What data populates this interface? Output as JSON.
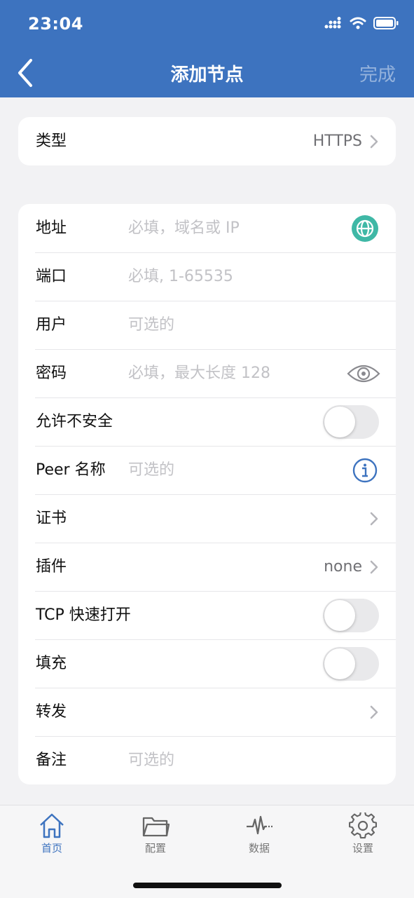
{
  "status": {
    "time": "23:04"
  },
  "nav": {
    "title": "添加节点",
    "done_label": "完成"
  },
  "type_card": {
    "label": "类型",
    "value": "HTTPS"
  },
  "form": {
    "address": {
      "label": "地址",
      "placeholder": "必填，域名或 IP"
    },
    "port": {
      "label": "端口",
      "placeholder": "必填, 1-65535"
    },
    "user": {
      "label": "用户",
      "placeholder": "可选的"
    },
    "password": {
      "label": "密码",
      "placeholder": "必填，最大长度 128"
    },
    "allow_insecure": {
      "label": "允许不安全",
      "on": false
    },
    "peer_name": {
      "label": "Peer 名称",
      "placeholder": "可选的"
    },
    "certificate": {
      "label": "证书"
    },
    "plugin": {
      "label": "插件",
      "value": "none"
    },
    "tcp_fast_open": {
      "label": "TCP 快速打开",
      "on": false
    },
    "padding": {
      "label": "填充",
      "on": false
    },
    "forward": {
      "label": "转发"
    },
    "remark": {
      "label": "备注",
      "placeholder": "可选的"
    }
  },
  "tabs": [
    {
      "label": "首页",
      "icon": "home-icon",
      "active": true
    },
    {
      "label": "配置",
      "icon": "folder-icon",
      "active": false
    },
    {
      "label": "数据",
      "icon": "activity-icon",
      "active": false
    },
    {
      "label": "设置",
      "icon": "gear-icon",
      "active": false
    }
  ],
  "colors": {
    "accent": "#3d73bf",
    "globe": "#3fb8a6",
    "page_bg": "#f2f2f4"
  }
}
